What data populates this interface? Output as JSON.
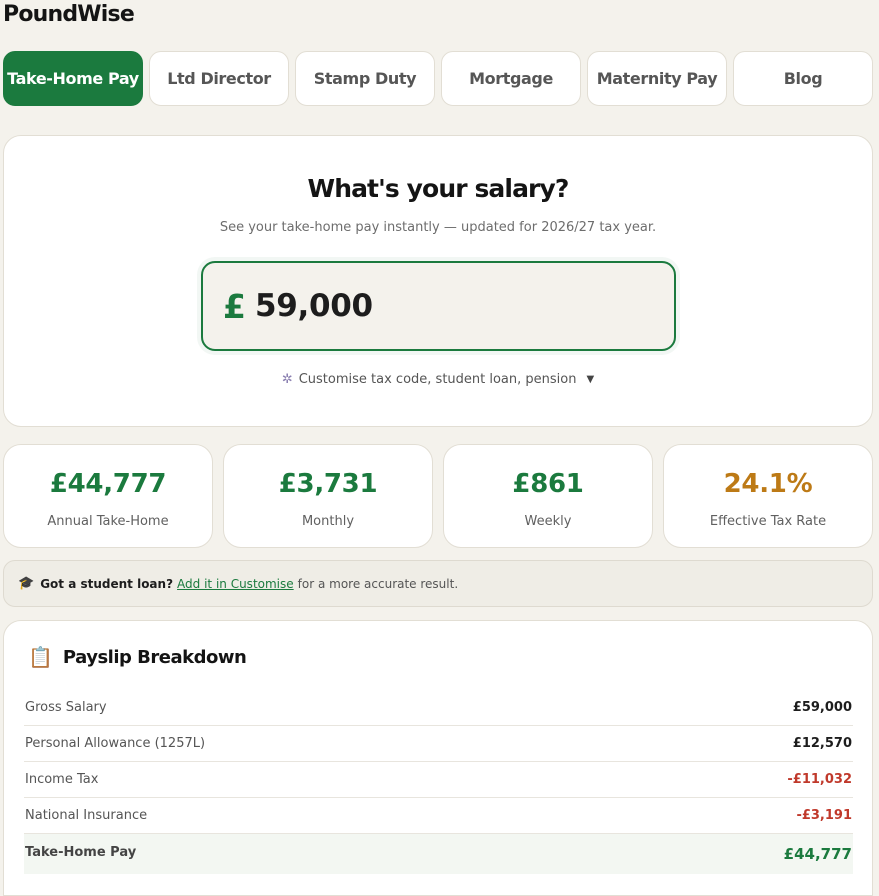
{
  "app": {
    "brand": "PoundWise"
  },
  "tabs": [
    {
      "label": "Take-Home Pay",
      "active": true
    },
    {
      "label": "Ltd Director",
      "active": false
    },
    {
      "label": "Stamp Duty",
      "active": false
    },
    {
      "label": "Mortgage",
      "active": false
    },
    {
      "label": "Maternity Pay",
      "active": false
    },
    {
      "label": "Blog",
      "active": false
    }
  ],
  "hero": {
    "title": "What's your salary?",
    "subtitle": "See your take-home pay instantly — updated for 2026/27 tax year.",
    "currency_symbol": "£",
    "salary_value": "59,000",
    "customise_icon": "gear-icon",
    "customise_label": "Customise tax code, student loan, pension",
    "customise_chevron": "▼"
  },
  "stats": [
    {
      "value": "£44,777",
      "label": "Annual Take-Home"
    },
    {
      "value": "£3,731",
      "label": "Monthly"
    },
    {
      "value": "£861",
      "label": "Weekly"
    },
    {
      "value": "24.1%",
      "label": "Effective Tax Rate"
    }
  ],
  "notice": {
    "icon": "graduation-cap-icon",
    "bold": "Got a student loan?",
    "link": "Add it in Customise",
    "rest": "for a more accurate result."
  },
  "payslip": {
    "icon": "clipboard-icon",
    "title": "Payslip Breakdown",
    "rows": [
      {
        "label": "Gross Salary",
        "value": "£59,000"
      },
      {
        "label": "Personal Allowance (1257L)",
        "value": "£12,570"
      },
      {
        "label": "Income Tax",
        "value": "-£11,032"
      },
      {
        "label": "National Insurance",
        "value": "-£3,191"
      },
      {
        "label": "Take-Home Pay",
        "value": "£44,777"
      }
    ]
  },
  "colors": {
    "accent_green": "#1b7a3e",
    "amber": "#bd7a16",
    "negative_red": "#c0392b",
    "background": "#f4f2ec"
  }
}
